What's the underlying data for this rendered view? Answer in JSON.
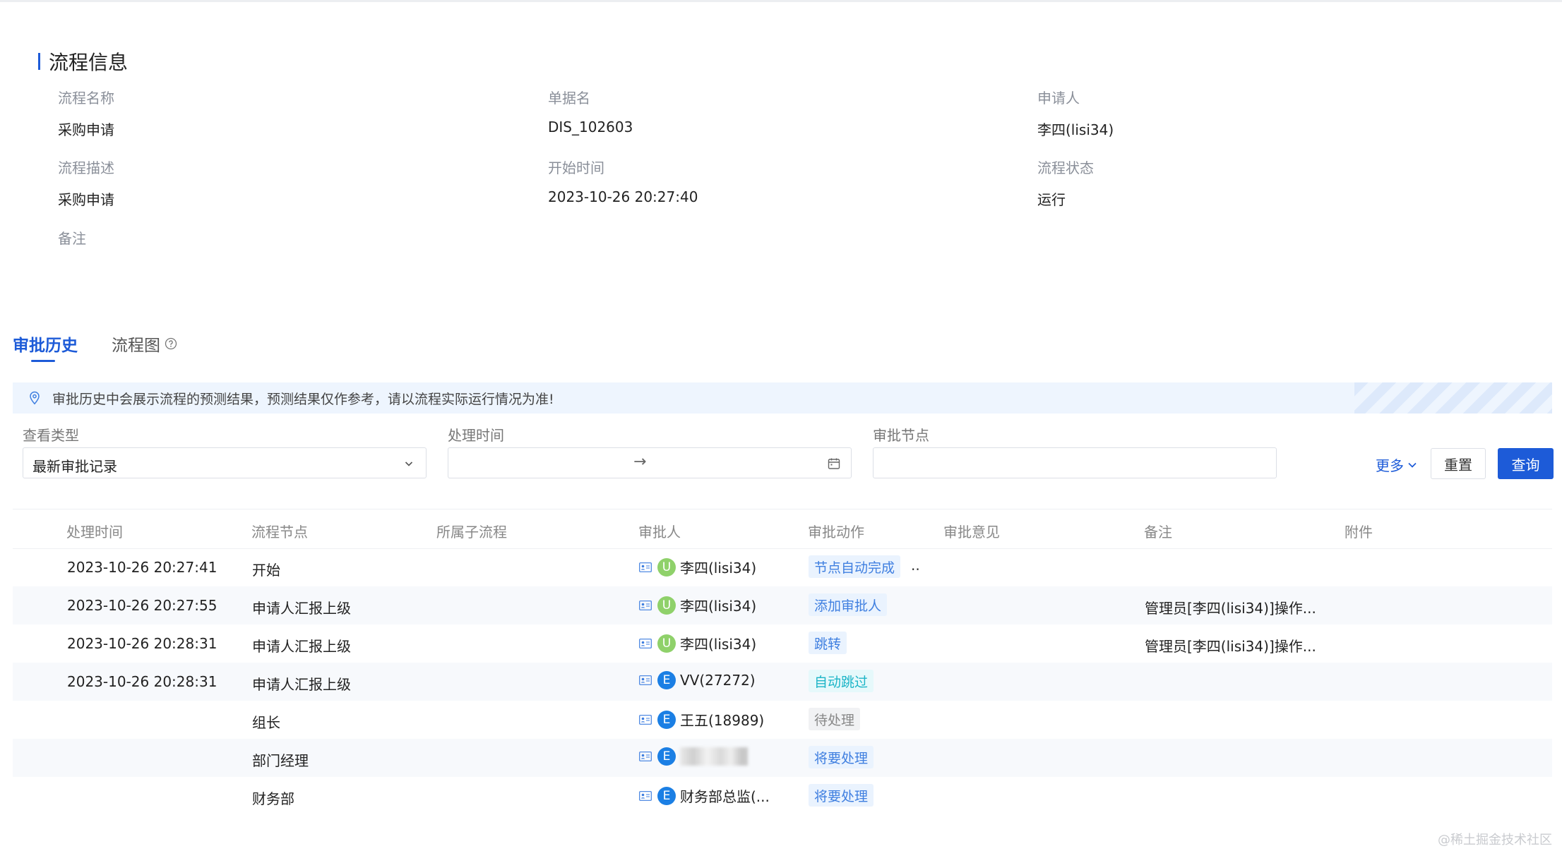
{
  "process_info": {
    "title": "流程信息",
    "fields": [
      {
        "label": "流程名称",
        "value": "采购申请"
      },
      {
        "label": "单据名",
        "value": "DIS_102603"
      },
      {
        "label": "申请人",
        "value": "李四(lisi34)"
      },
      {
        "label": "流程描述",
        "value": "采购申请"
      },
      {
        "label": "开始时间",
        "value": "2023-10-26 20:27:40"
      },
      {
        "label": "流程状态",
        "value": "运行"
      },
      {
        "label": "备注",
        "value": ""
      }
    ]
  },
  "tabs": [
    {
      "label": "审批历史",
      "active": true
    },
    {
      "label": "流程图",
      "active": false
    }
  ],
  "notice": "审批历史中会展示流程的预测结果，预测结果仅作参考，请以流程实际运行情况为准!",
  "filters": {
    "view_type": {
      "label": "查看类型",
      "value": "最新审批记录"
    },
    "process_time": {
      "label": "处理时间",
      "separator": "→"
    },
    "node": {
      "label": "审批节点",
      "value": ""
    },
    "more": "更多",
    "reset": "重置",
    "query": "查询"
  },
  "table": {
    "columns": [
      "处理时间",
      "流程节点",
      "所属子流程",
      "审批人",
      "审批动作",
      "审批意见",
      "备注",
      "附件"
    ],
    "rows": [
      {
        "time": "2023-10-26 20:27:41",
        "node": "开始",
        "avatar": "U",
        "approver": "李四(lisi34)",
        "action": "节点自动完成",
        "action_style": "blue",
        "opinion": "..",
        "note": ""
      },
      {
        "time": "2023-10-26 20:27:55",
        "node": "申请人汇报上级",
        "avatar": "U",
        "approver": "李四(lisi34)",
        "action": "添加审批人",
        "action_style": "blue",
        "opinion": "",
        "note": "管理员[李四(lisi34)]操作..."
      },
      {
        "time": "2023-10-26 20:28:31",
        "node": "申请人汇报上级",
        "avatar": "U",
        "approver": "李四(lisi34)",
        "action": "跳转",
        "action_style": "blue",
        "opinion": "",
        "note": "管理员[李四(lisi34)]操作..."
      },
      {
        "time": "2023-10-26 20:28:31",
        "node": "申请人汇报上级",
        "avatar": "E",
        "approver": "VV(27272)",
        "action": "自动跳过",
        "action_style": "cyan",
        "opinion": "",
        "note": ""
      },
      {
        "time": "",
        "node": "组长",
        "avatar": "E",
        "approver": "王五(18989)",
        "action": "待处理",
        "action_style": "gray",
        "opinion": "",
        "note": ""
      },
      {
        "time": "",
        "node": "部门经理",
        "avatar": "E",
        "approver": "",
        "action": "将要处理",
        "action_style": "blue",
        "opinion": "",
        "note": ""
      },
      {
        "time": "",
        "node": "财务部",
        "avatar": "E",
        "approver": "财务部总监(...",
        "action": "将要处理",
        "action_style": "blue",
        "opinion": "",
        "note": ""
      }
    ]
  },
  "watermark": "@稀土掘金技术社区",
  "colors": {
    "primary": "#1d5bd8",
    "avatar_u": "#8fd16a",
    "avatar_e": "#1b7fe4"
  },
  "icons": [
    "help-icon",
    "location-pin-icon",
    "chevron-down-icon",
    "calendar-icon",
    "contact-card-icon"
  ]
}
